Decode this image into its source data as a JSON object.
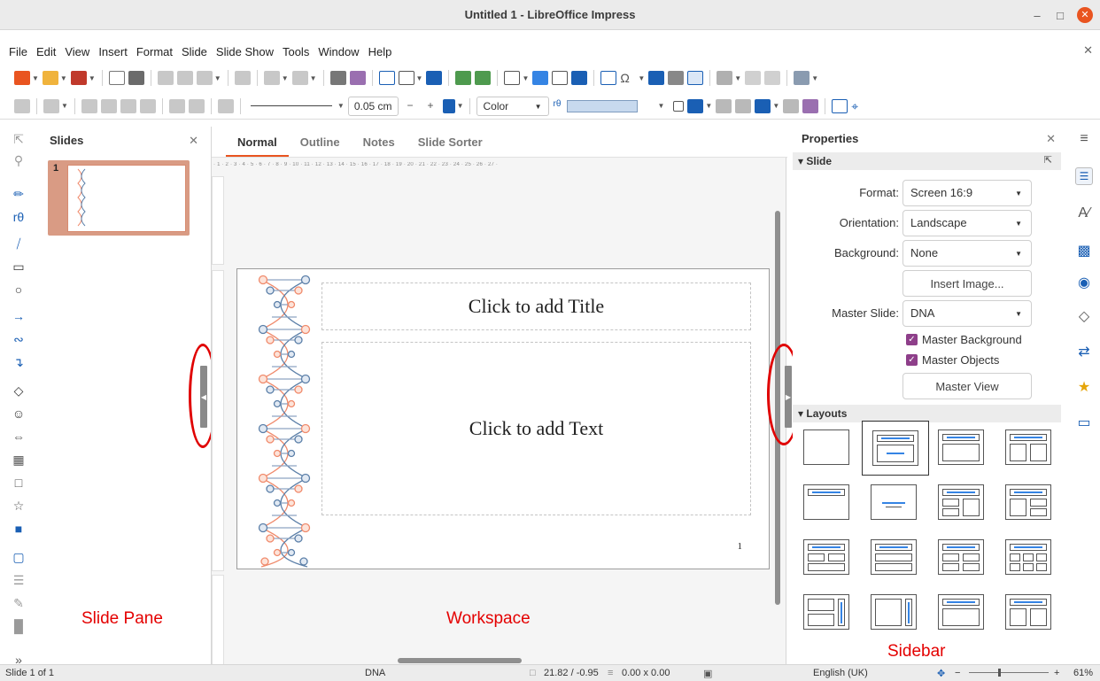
{
  "window": {
    "title": "Untitled 1 - LibreOffice Impress"
  },
  "menu": [
    "File",
    "Edit",
    "View",
    "Insert",
    "Format",
    "Slide",
    "Slide Show",
    "Tools",
    "Window",
    "Help"
  ],
  "toolbar": {
    "line_width": "0.05 cm",
    "area_style": "Color",
    "minus": "−",
    "plus": "+"
  },
  "slides_pane": {
    "title": "Slides",
    "slide_number": "1"
  },
  "workspace": {
    "tabs": [
      "Normal",
      "Outline",
      "Notes",
      "Slide Sorter"
    ],
    "active_tab": "Normal",
    "ruler_text": "· 1 · 2 · 3 · 4 · 5 · 6 · 7 · 8 · 9 · 10 · 11 · 12 · 13 · 14 · 15 · 16 · 17 · 18 · 19 · 20 · 21 · 22 · 23 · 24 · 25 · 26 · 27 ·",
    "title_placeholder": "Click to add Title",
    "text_placeholder": "Click to add Text",
    "page_number": "1"
  },
  "sidebar": {
    "title": "Properties",
    "slide_section": "Slide",
    "format_label": "Format:",
    "format_value": "Screen 16:9",
    "orientation_label": "Orientation:",
    "orientation_value": "Landscape",
    "background_label": "Background:",
    "background_value": "None",
    "insert_image": "Insert Image...",
    "master_slide_label": "Master Slide:",
    "master_slide_value": "DNA",
    "master_background": "Master Background",
    "master_objects": "Master Objects",
    "master_view": "Master View",
    "layouts_section": "Layouts"
  },
  "annotations": {
    "slide_pane": "Slide Pane",
    "workspace": "Workspace",
    "sidebar": "Sidebar"
  },
  "status": {
    "slide": "Slide 1 of 1",
    "master": "DNA",
    "position": "21.82 / -0.95",
    "size": "0.00 x 0.00",
    "language": "English (UK)",
    "zoom": "61%"
  },
  "colors": {
    "accent": "#e95420",
    "dna_orange": "#f08a6b",
    "dna_blue": "#5b7fa8",
    "annotation_red": "#e40000"
  }
}
